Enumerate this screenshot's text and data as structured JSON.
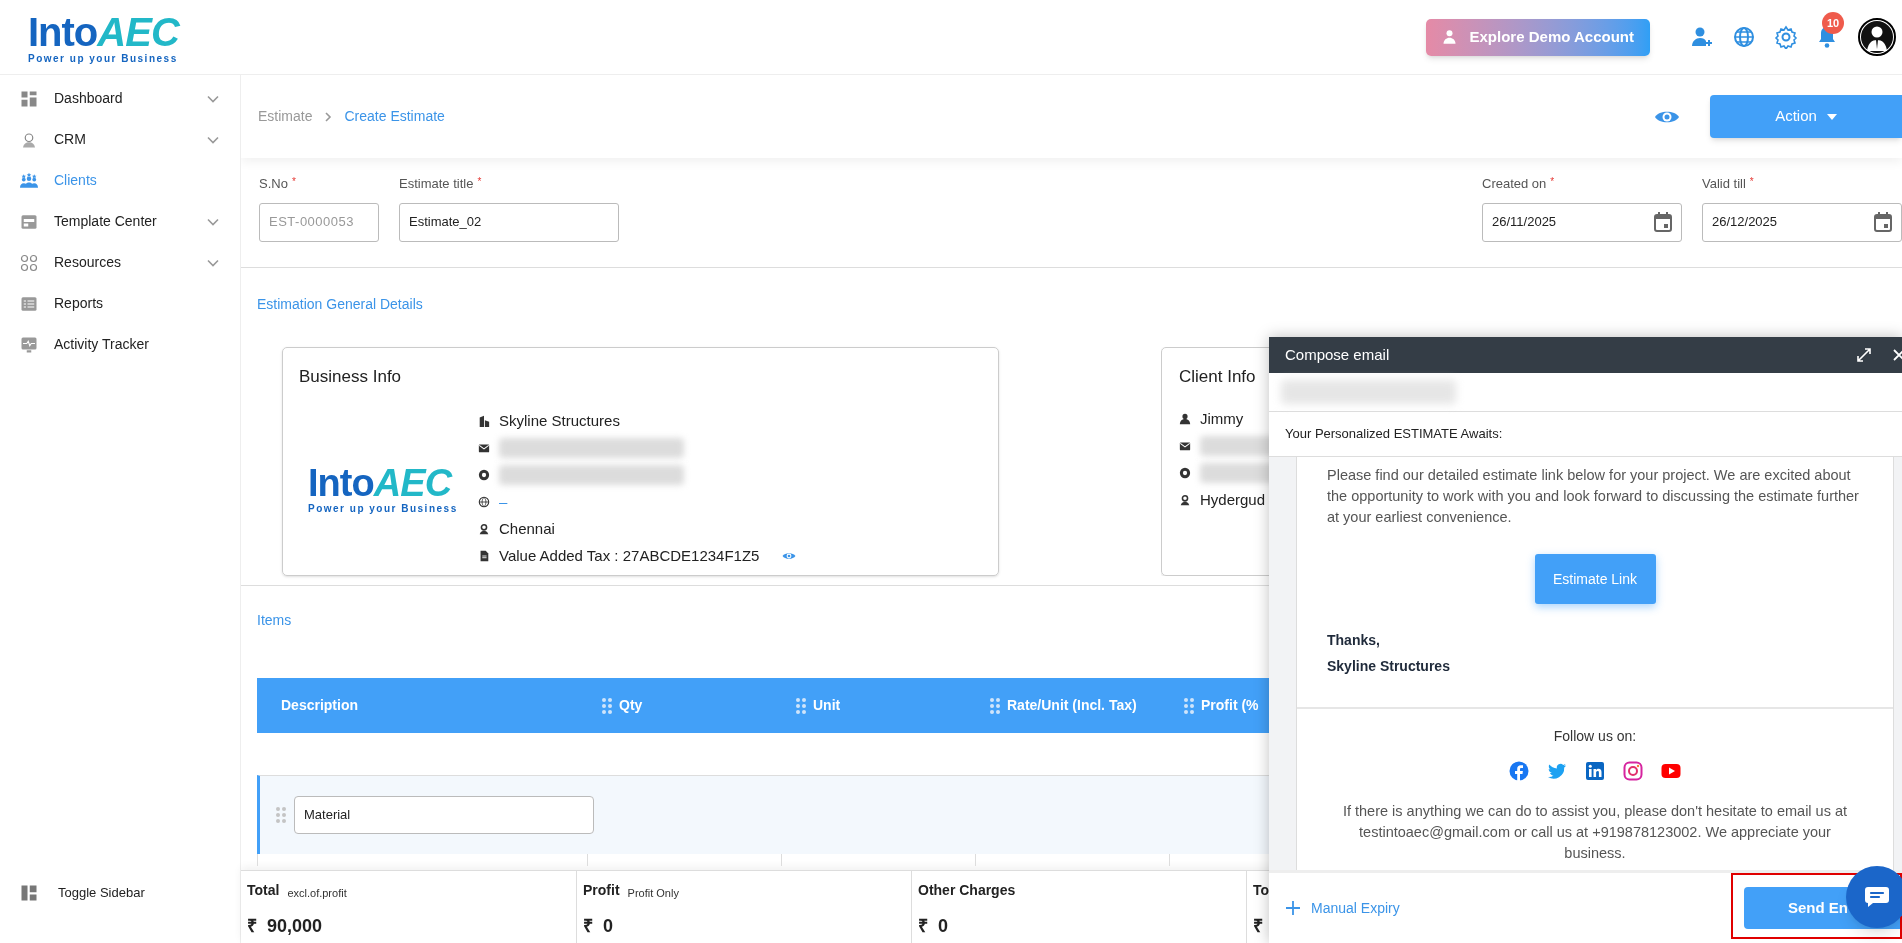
{
  "header": {
    "logo": {
      "brand_start": "Into",
      "brand_end": "AEC",
      "tagline": "Power up your Business"
    },
    "demo_button": "Explore Demo Account",
    "notifications_badge": "10"
  },
  "sidebar": {
    "items": [
      {
        "label": "Dashboard",
        "expandable": true,
        "selected": false
      },
      {
        "label": "CRM",
        "expandable": true,
        "selected": false
      },
      {
        "label": "Clients",
        "expandable": false,
        "selected": true
      },
      {
        "label": "Template Center",
        "expandable": true,
        "selected": false
      },
      {
        "label": "Resources",
        "expandable": true,
        "selected": false
      },
      {
        "label": "Reports",
        "expandable": false,
        "selected": false
      },
      {
        "label": "Activity Tracker",
        "expandable": false,
        "selected": false
      }
    ],
    "toggle": "Toggle Sidebar"
  },
  "breadcrumb": [
    {
      "label": "Estimate",
      "current": false
    },
    {
      "label": "Create Estimate",
      "current": true
    }
  ],
  "action_button": "Action",
  "form": {
    "fields": [
      {
        "label": "S.No",
        "required_mark": "*",
        "value": "EST-0000053",
        "disabled": true,
        "kind": "text"
      },
      {
        "label": "Estimate title",
        "required_mark": "*",
        "value": "Estimate_02",
        "disabled": false,
        "kind": "text"
      },
      {
        "label": "Created on",
        "required_mark": "*",
        "value": "26/11/2025",
        "disabled": false,
        "kind": "date"
      },
      {
        "label": "Valid till",
        "required_mark": "*",
        "value": "26/12/2025",
        "disabled": false,
        "kind": "date"
      }
    ]
  },
  "general_details": {
    "title": "Estimation General Details",
    "business_info": {
      "title": "Business Info",
      "logo": {
        "brand_start": "Into",
        "brand_end": "AEC",
        "tagline": "Power up your Business"
      },
      "rows": [
        {
          "kind": "text",
          "text": "Skyline Structures"
        },
        {
          "kind": "redacted"
        },
        {
          "kind": "redacted"
        },
        {
          "kind": "link",
          "text": "–"
        },
        {
          "kind": "text",
          "text": "Chennai"
        },
        {
          "kind": "secret",
          "text": "Value Added Tax : 27ABCDE1234F1Z5"
        }
      ]
    },
    "client_info": {
      "title": "Client Info",
      "rows": [
        {
          "kind": "text",
          "text": "Jimmy"
        },
        {
          "kind": "redacted"
        },
        {
          "kind": "redacted"
        },
        {
          "kind": "text",
          "text": "Hydergud"
        }
      ]
    }
  },
  "items": {
    "title": "Items",
    "columns": [
      "Description",
      "Qty",
      "Unit",
      "Rate/Unit (Incl. Tax)",
      "Profit (%"
    ],
    "groups": [
      {
        "name": "Material"
      }
    ]
  },
  "totals": [
    {
      "label": "Total",
      "note": "excl.of.profit",
      "value": "₹  90,000"
    },
    {
      "label": "Profit",
      "note": "Profit Only",
      "value": "₹  0"
    },
    {
      "label": "Other Charges",
      "value": "₹  0"
    },
    {
      "label": "To",
      "value": "₹"
    }
  ],
  "compose_email": {
    "title": "Compose email",
    "subject": "Your Personalized ESTIMATE Awaits:",
    "message": "Please find our detailed estimate link below for your project. We are excited about the opportunity to work with you and look forward to discussing the estimate further at your earliest convenience.",
    "link_button": "Estimate Link",
    "sign_off": "Thanks,",
    "signature": "Skyline Structures",
    "follow_title": "Follow us on:",
    "social": [
      {
        "kind": "facebook"
      },
      {
        "kind": "twitter"
      },
      {
        "kind": "linkedin"
      },
      {
        "kind": "instagram"
      },
      {
        "kind": "youtube"
      }
    ],
    "footer_note": "If there is anything we can do to assist you, please don't hesitate to email us at testintoaec@gmail.com or call us at +919878123002. We appreciate your business.",
    "manual_expiry": "Manual Expiry",
    "send_button": "Send En"
  }
}
